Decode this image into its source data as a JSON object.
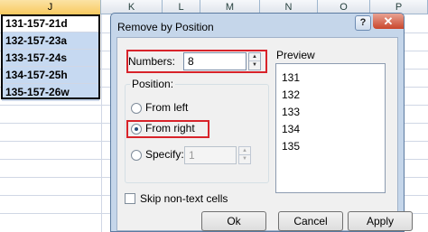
{
  "sheet": {
    "column_headers": [
      "J",
      "K",
      "L",
      "M",
      "N",
      "O",
      "P"
    ],
    "cells": [
      "131-157-21d",
      "132-157-23a",
      "133-157-24s",
      "134-157-25h",
      "135-157-26w"
    ]
  },
  "dialog": {
    "title": "Remove by Position",
    "help_glyph": "?",
    "close_glyph": "✕",
    "numbers_label": "Numbers:",
    "numbers_value": "8",
    "position_legend": "Position:",
    "options": {
      "from_left": "From left",
      "from_right": "From right",
      "specify": "Specify:",
      "specify_value": "1"
    },
    "selected_option": "from_right",
    "skip_label": "Skip non-text cells",
    "skip_checked": false,
    "preview_label": "Preview",
    "preview_items": [
      "131",
      "132",
      "133",
      "134",
      "135"
    ],
    "buttons": {
      "ok": "Ok",
      "cancel": "Cancel",
      "apply": "Apply"
    }
  },
  "colors": {
    "highlight_cells": "#c6d9f1",
    "annotation_red": "#d8232a",
    "dialog_frame": "#c5d6ea"
  }
}
